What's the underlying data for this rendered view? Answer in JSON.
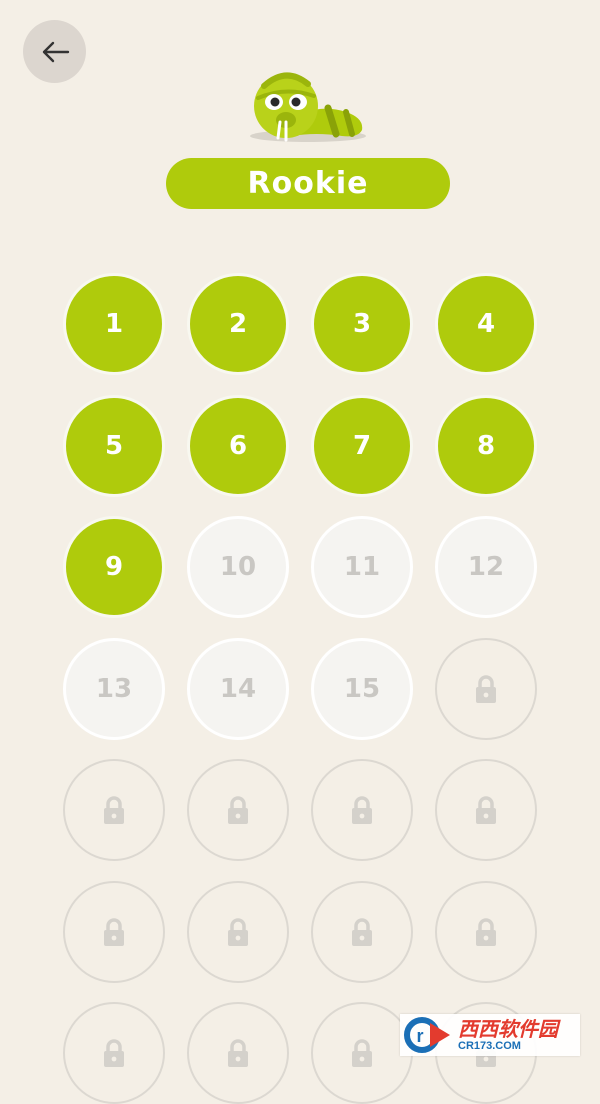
{
  "header": {
    "rank_title": "Rookie"
  },
  "icons": {
    "back": "arrow-left-icon",
    "mascot": "snake-mascot-icon",
    "locked": "lock-icon"
  },
  "colors": {
    "background": "#f4efe6",
    "accent": "#afcb0c",
    "open_level": "#f5f4f1",
    "lock": "#d4d1cb"
  },
  "levels": [
    {
      "label": "1",
      "state": "completed"
    },
    {
      "label": "2",
      "state": "completed"
    },
    {
      "label": "3",
      "state": "completed"
    },
    {
      "label": "4",
      "state": "completed"
    },
    {
      "label": "5",
      "state": "completed"
    },
    {
      "label": "6",
      "state": "completed"
    },
    {
      "label": "7",
      "state": "completed"
    },
    {
      "label": "8",
      "state": "completed"
    },
    {
      "label": "9",
      "state": "completed"
    },
    {
      "label": "10",
      "state": "open"
    },
    {
      "label": "11",
      "state": "open"
    },
    {
      "label": "12",
      "state": "open"
    },
    {
      "label": "13",
      "state": "open"
    },
    {
      "label": "14",
      "state": "open"
    },
    {
      "label": "15",
      "state": "open"
    },
    {
      "label": "",
      "state": "locked"
    },
    {
      "label": "",
      "state": "locked"
    },
    {
      "label": "",
      "state": "locked"
    },
    {
      "label": "",
      "state": "locked"
    },
    {
      "label": "",
      "state": "locked"
    },
    {
      "label": "",
      "state": "locked"
    },
    {
      "label": "",
      "state": "locked"
    },
    {
      "label": "",
      "state": "locked"
    },
    {
      "label": "",
      "state": "locked"
    },
    {
      "label": "",
      "state": "locked"
    },
    {
      "label": "",
      "state": "locked"
    },
    {
      "label": "",
      "state": "locked"
    },
    {
      "label": "",
      "state": "locked"
    }
  ],
  "watermark": {
    "brand": "西西软件园",
    "url": "CR173.COM"
  }
}
